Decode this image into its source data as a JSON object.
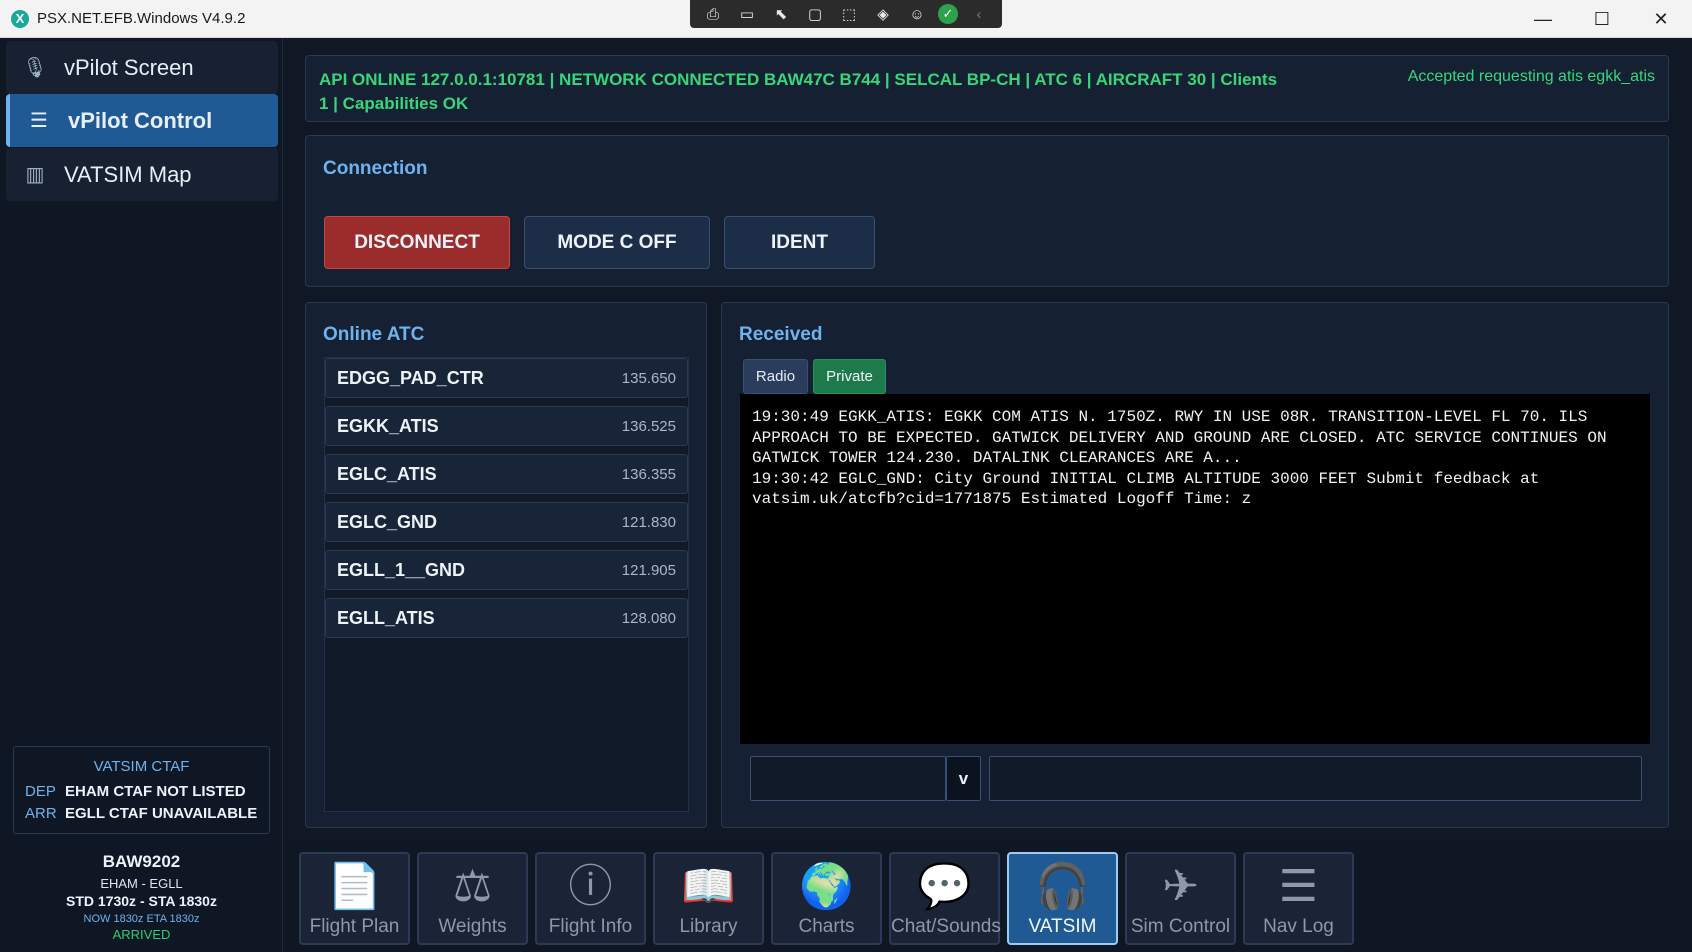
{
  "window": {
    "title": "PSX.NET.EFB.Windows V4.9.2",
    "app_icon": "X",
    "controls": {
      "minimize": "—",
      "maximize": "☐",
      "close": "✕"
    }
  },
  "capture_toolbar": [
    "⎙",
    "▭",
    "⬉",
    "▢",
    "⬚",
    "◈",
    "☺",
    "✓",
    "‹"
  ],
  "sidebar": {
    "items": [
      {
        "label": "vPilot Screen",
        "icon": "microphone-icon",
        "glyph": "🎙"
      },
      {
        "label": "vPilot Control",
        "icon": "sliders-icon",
        "glyph": "☰"
      },
      {
        "label": "VATSIM Map",
        "icon": "map-icon",
        "glyph": "▥"
      }
    ],
    "ctaf": {
      "title": "VATSIM CTAF",
      "dep_label": "DEP",
      "dep_value": "EHAM CTAF NOT LISTED",
      "arr_label": "ARR",
      "arr_value": "EGLL CTAF UNAVAILABLE"
    },
    "flight": {
      "callsign": "BAW9202",
      "route": "EHAM  -  EGLL",
      "times": "STD 1730z  -  STA 1830z",
      "now": "NOW 1830z   ETA 1830z",
      "status": "ARRIVED"
    }
  },
  "status_bar": {
    "text": "API ONLINE 127.0.0.1:10781 | NETWORK CONNECTED BAW47C B744 | SELCAL BP-CH | ATC 6 | AIRCRAFT 30 | Clients 1 | Capabilities OK",
    "message": "Accepted requesting atis egkk_atis"
  },
  "connection": {
    "title": "Connection",
    "disconnect": "DISCONNECT",
    "mode_c": "MODE C OFF",
    "ident": "IDENT"
  },
  "online_atc": {
    "title": "Online ATC",
    "stations": [
      {
        "callsign": "EDGG_PAD_CTR",
        "freq": "135.650"
      },
      {
        "callsign": "EGKK_ATIS",
        "freq": "136.525"
      },
      {
        "callsign": "EGLC_ATIS",
        "freq": "136.355"
      },
      {
        "callsign": "EGLC_GND",
        "freq": "121.830"
      },
      {
        "callsign": "EGLL_1__GND",
        "freq": "121.905"
      },
      {
        "callsign": "EGLL_ATIS",
        "freq": "128.080"
      }
    ]
  },
  "received": {
    "title": "Received",
    "tabs": {
      "radio": "Radio",
      "private": "Private"
    },
    "log": "19:30:49 EGKK_ATIS: EGKK COM ATIS N. 1750Z. RWY IN USE 08R. TRANSITION-LEVEL FL 70. ILS APPROACH TO BE EXPECTED. GATWICK DELIVERY AND GROUND ARE CLOSED. ATC SERVICE CONTINUES ON GATWICK TOWER 124.230. DATALINK CLEARANCES ARE A...\n19:30:42 EGLC_GND: City Ground INITIAL CLIMB ALTITUDE 3000 FEET Submit feedback at vatsim.uk/atcfb?cid=1771875 Estimated Logoff Time: z",
    "compose_combo_value": "",
    "compose_drop": "v",
    "compose_value": ""
  },
  "bottom_nav": [
    {
      "label": "Flight Plan",
      "icon": "document-icon",
      "glyph": "📄"
    },
    {
      "label": "Weights",
      "icon": "scale-icon",
      "glyph": "⚖"
    },
    {
      "label": "Flight Info",
      "icon": "info-icon",
      "glyph": "ⓘ"
    },
    {
      "label": "Library",
      "icon": "book-icon",
      "glyph": "📖"
    },
    {
      "label": "Charts",
      "icon": "globe-icon",
      "glyph": "🌍"
    },
    {
      "label": "Chat/Sounds",
      "icon": "chat-icon",
      "glyph": "💬"
    },
    {
      "label": "VATSIM",
      "icon": "headset-icon",
      "glyph": "🎧"
    },
    {
      "label": "Sim Control",
      "icon": "plane-icon",
      "glyph": "✈"
    },
    {
      "label": "Nav Log",
      "icon": "list-icon",
      "glyph": "☰"
    }
  ],
  "active_bottom": "VATSIM",
  "colors": {
    "accent": "#6fb2ee",
    "online_green": "#37d67a",
    "danger": "#9b2c2c",
    "active": "#1f5a94"
  }
}
